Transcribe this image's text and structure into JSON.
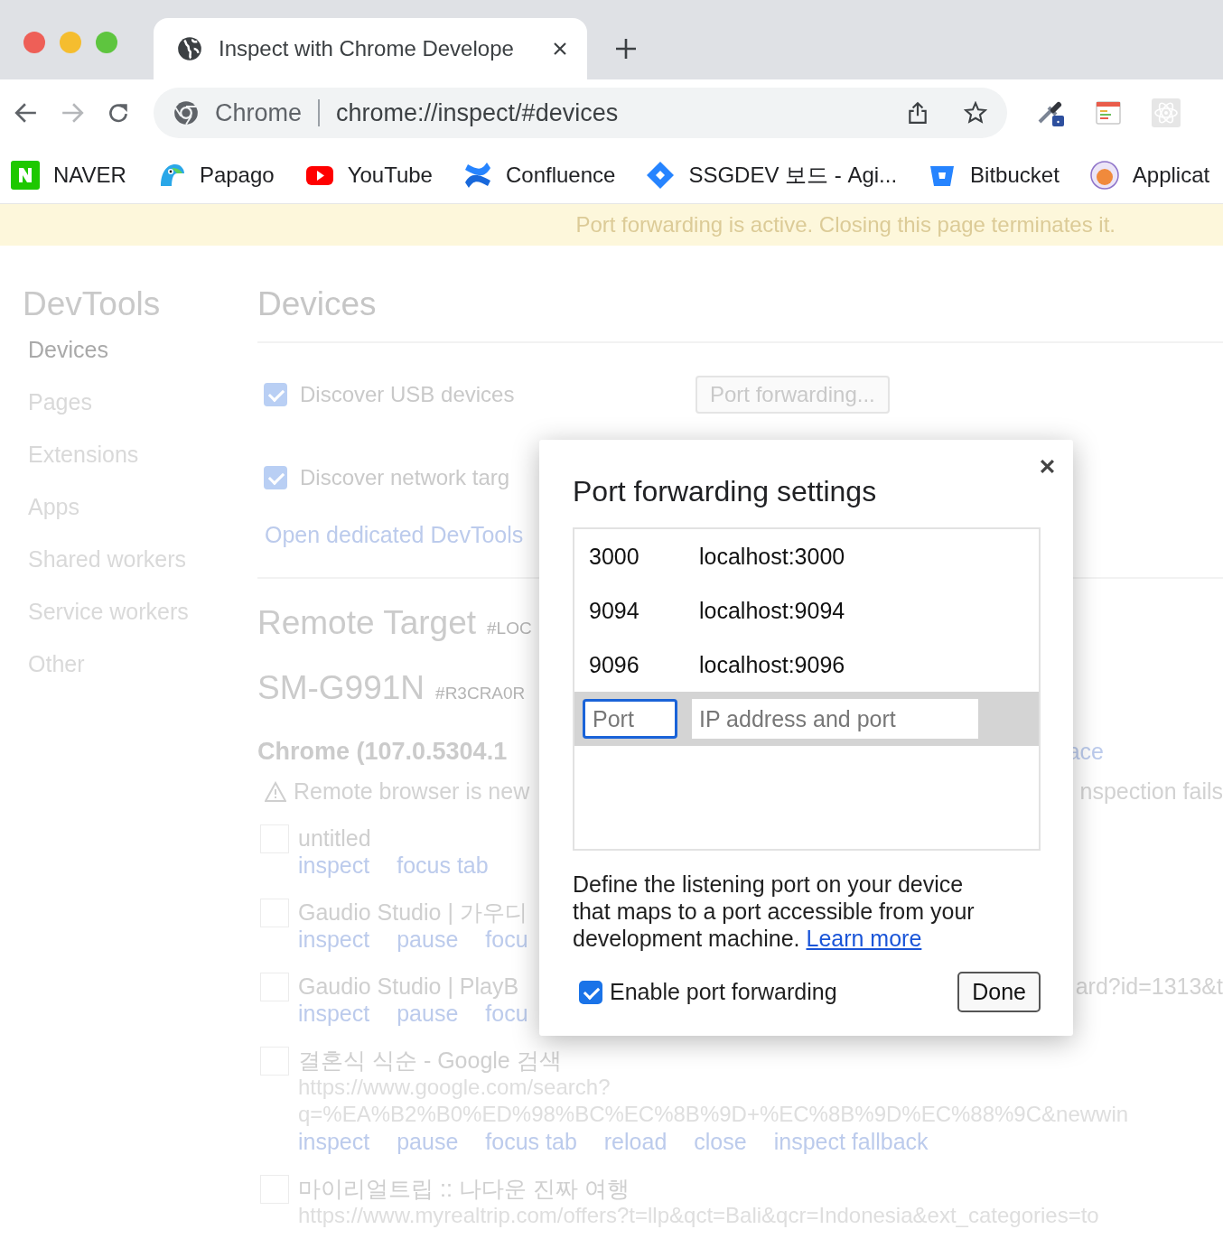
{
  "browser": {
    "tab": {
      "title": "Inspect with Chrome Develope",
      "selected": true
    },
    "address_bar": {
      "site_label": "Chrome",
      "url": "chrome://inspect/#devices"
    },
    "bookmarks": [
      {
        "label": "NAVER",
        "kind": "naver"
      },
      {
        "label": "Papago",
        "kind": "papago"
      },
      {
        "label": "YouTube",
        "kind": "youtube"
      },
      {
        "label": "Confluence",
        "kind": "confluence"
      },
      {
        "label": "SSGDEV 보드 - Agi...",
        "kind": "jira"
      },
      {
        "label": "Bitbucket",
        "kind": "bitbucket"
      },
      {
        "label": "Applicat",
        "kind": "avatar"
      }
    ]
  },
  "infobar": "Port forwarding is active. Closing this page terminates it.",
  "sidebar": {
    "title": "DevTools",
    "items": [
      {
        "label": "Devices",
        "selected": true
      },
      {
        "label": "Pages",
        "selected": false
      },
      {
        "label": "Extensions",
        "selected": false
      },
      {
        "label": "Apps",
        "selected": false
      },
      {
        "label": "Shared workers",
        "selected": false
      },
      {
        "label": "Service workers",
        "selected": false
      },
      {
        "label": "Other",
        "selected": false
      }
    ]
  },
  "main": {
    "title": "Devices",
    "options": [
      {
        "label": "Discover USB devices",
        "checked": true
      },
      {
        "label": "Discover network targ",
        "checked": true
      }
    ],
    "port_forwarding_button": "Port forwarding...",
    "devtools_link": "Open dedicated DevTools",
    "remote_target": {
      "title": "Remote Target",
      "id": "#LOC"
    },
    "device": {
      "name": "SM-G991N",
      "serial": "#R3CRA0R"
    },
    "browser": {
      "name": "Chrome (107.0.5304.1",
      "trailing_link": "ace"
    },
    "warning": {
      "text": "Remote browser is new",
      "trailing": "nspection fails"
    },
    "targets": [
      {
        "title": "untitled",
        "actions": [
          "inspect",
          "focus tab"
        ]
      },
      {
        "title": "Gaudio Studio | 가우디",
        "actions": [
          "inspect",
          "pause",
          "focu"
        ]
      },
      {
        "title": "Gaudio Studio | PlayB",
        "trailing": "ard?id=1313&t",
        "actions": [
          "inspect",
          "pause",
          "focu"
        ]
      },
      {
        "title": "결혼식 식순 - Google 검색",
        "url_lines": [
          "https://www.google.com/search?",
          "q=%EA%B2%B0%ED%98%BC%EC%8B%9D+%EC%8B%9D%EC%88%9C&newwin"
        ],
        "actions": [
          "inspect",
          "pause",
          "focus tab",
          "reload",
          "close",
          "inspect fallback"
        ]
      },
      {
        "title": "마이리얼트립 :: 나다운 진짜 여행",
        "url_lines": [
          "https://www.myrealtrip.com/offers?t=llp&qct=Bali&qcr=Indonesia&ext_categories=to"
        ]
      }
    ]
  },
  "dialog": {
    "title": "Port forwarding settings",
    "rules": [
      {
        "device_port": "3000",
        "local_address": "localhost:3000"
      },
      {
        "device_port": "9094",
        "local_address": "localhost:9094"
      },
      {
        "device_port": "9096",
        "local_address": "localhost:9096"
      }
    ],
    "new_rule": {
      "port_placeholder": "Port",
      "address_placeholder": "IP address and port",
      "port_focused": true
    },
    "description": "Define the listening port on your device that maps to a port accessible from your development machine.",
    "learn_more": "Learn more",
    "enable": {
      "label": "Enable port forwarding",
      "checked": true
    },
    "done_button": "Done"
  }
}
